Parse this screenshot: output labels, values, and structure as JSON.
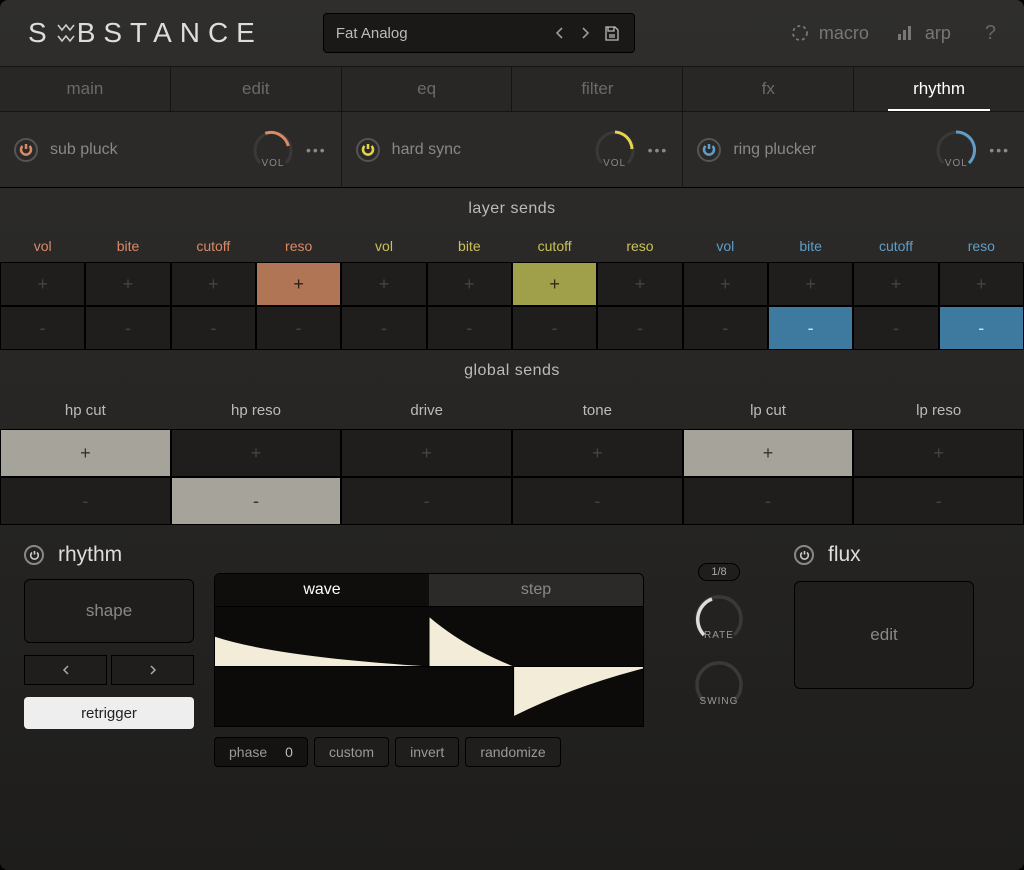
{
  "brand": "SUBSTANCE",
  "brand_pre": "S",
  "brand_post": "BSTANCE",
  "preset": {
    "name": "Fat Analog"
  },
  "header": {
    "macro": "macro",
    "arp": "arp",
    "help": "?"
  },
  "tabs": [
    "main",
    "edit",
    "eq",
    "filter",
    "fx",
    "rhythm"
  ],
  "active_tab": 5,
  "layers": [
    {
      "name": "sub pluck",
      "color": "#d88b66",
      "vol": "VOL"
    },
    {
      "name": "hard sync",
      "color": "#e3d44a",
      "vol": "VOL"
    },
    {
      "name": "ring plucker",
      "color": "#5e9ec8",
      "vol": "VOL"
    }
  ],
  "layer_sends": {
    "title": "layer sends",
    "headers": [
      "vol",
      "bite",
      "cutoff",
      "reso"
    ],
    "groups": [
      {
        "plus_hi": [
          false,
          false,
          false,
          true
        ],
        "minus_hi": [
          false,
          false,
          false,
          false
        ],
        "hiClass": "hi-orange"
      },
      {
        "plus_hi": [
          false,
          false,
          true,
          false
        ],
        "minus_hi": [
          false,
          false,
          false,
          false
        ],
        "hiClass": "hi-yellow"
      },
      {
        "plus_hi": [
          false,
          false,
          false,
          false
        ],
        "minus_hi": [
          false,
          true,
          false,
          true
        ],
        "hiClass": "hi-blue"
      }
    ]
  },
  "global_sends": {
    "title": "global sends",
    "headers": [
      "hp cut",
      "hp reso",
      "drive",
      "tone",
      "lp cut",
      "lp reso"
    ],
    "plus_hi": [
      true,
      false,
      false,
      false,
      true,
      false
    ],
    "minus_hi": [
      false,
      true,
      false,
      false,
      false,
      false
    ]
  },
  "rhythm": {
    "title": "rhythm",
    "shape": "shape",
    "retrigger": "retrigger",
    "wave_tabs": [
      "wave",
      "step"
    ],
    "active_wave_tab": 0,
    "phase_label": "phase",
    "phase_value": "0",
    "buttons": [
      "custom",
      "invert",
      "randomize"
    ],
    "rate_division": "1/8",
    "rate_label": "RATE",
    "swing_label": "SWING"
  },
  "flux": {
    "title": "flux",
    "edit": "edit"
  },
  "glyphs": {
    "plus": "+",
    "minus": "-",
    "more": "•••"
  }
}
